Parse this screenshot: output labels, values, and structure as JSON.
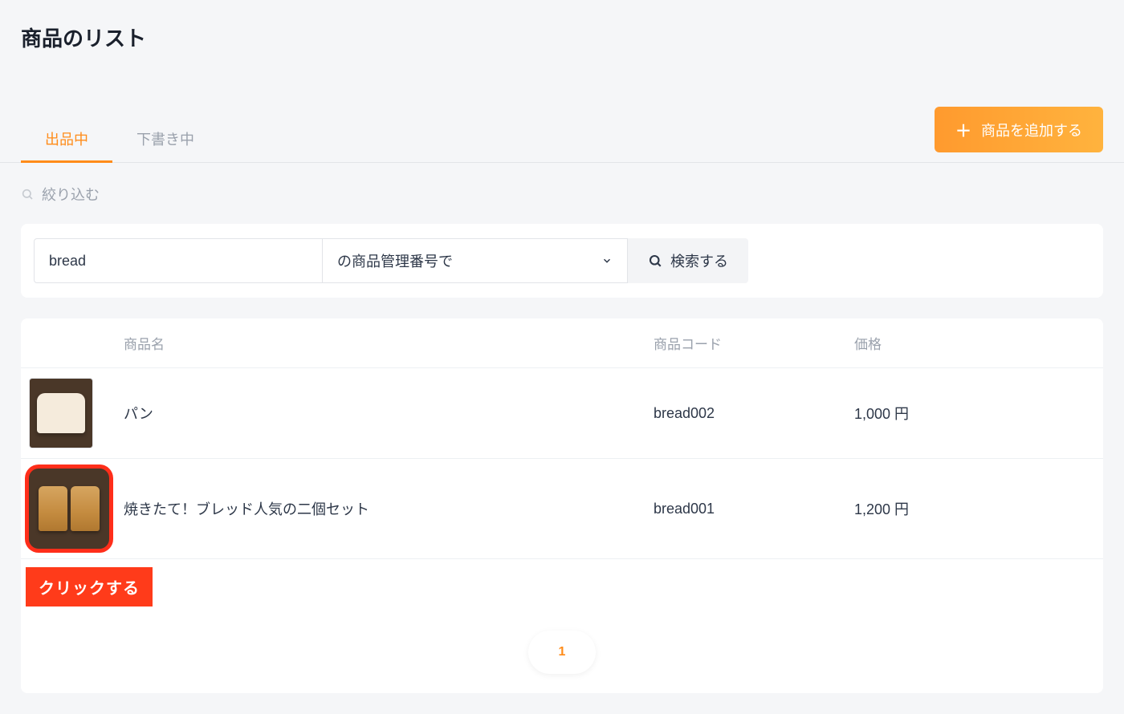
{
  "page": {
    "title": "商品のリスト"
  },
  "tabs": {
    "active": "出品中",
    "draft": "下書き中"
  },
  "addButton": {
    "label": "商品を追加する"
  },
  "filter": {
    "label": "絞り込む"
  },
  "search": {
    "value": "bread",
    "selectLabel": "の商品管理番号で",
    "buttonLabel": "検索する"
  },
  "table": {
    "headers": {
      "name": "商品名",
      "code": "商品コード",
      "price": "価格"
    },
    "rows": [
      {
        "name": "パン",
        "code": "bread002",
        "price": "1,000 円",
        "highlighted": false
      },
      {
        "name": "焼きたて！ブレッド人気の二個セット",
        "code": "bread001",
        "price": "1,200 円",
        "highlighted": true
      }
    ]
  },
  "callout": {
    "text": "クリックする"
  },
  "pagination": {
    "current": "1"
  }
}
